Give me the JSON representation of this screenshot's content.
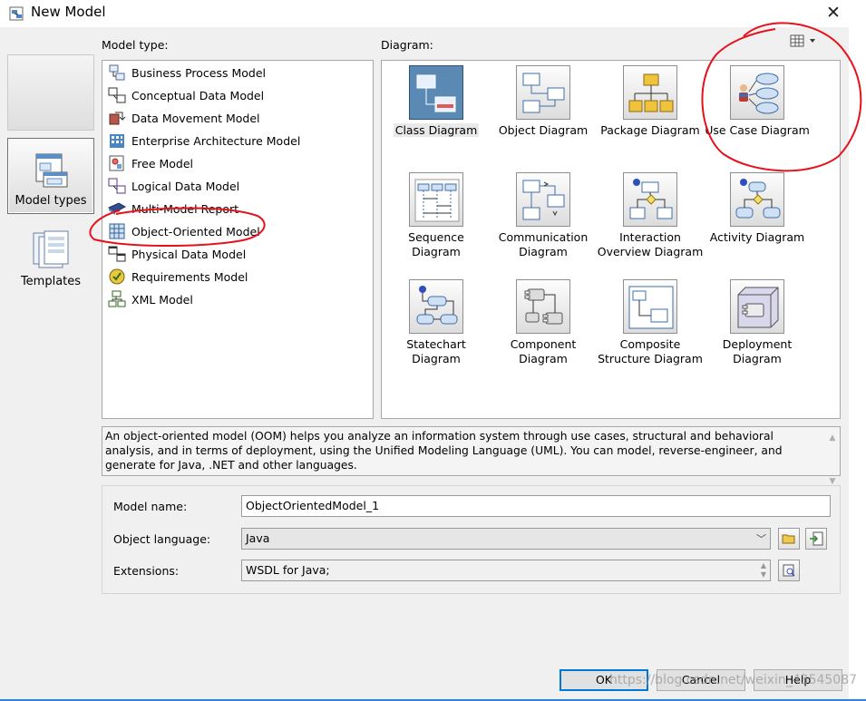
{
  "window": {
    "title": "New Model",
    "close_glyph": "✕",
    "app_icon": "new-model-app-icon"
  },
  "sidebar": {
    "items": [
      {
        "label": "",
        "icon": "blank-category-icon"
      },
      {
        "label": "Model types",
        "icon": "model-types-icon",
        "selected": true
      },
      {
        "label": "Templates",
        "icon": "templates-icon"
      }
    ]
  },
  "model_type": {
    "label": "Model type:",
    "selected": "Object-Oriented Model",
    "items": [
      {
        "label": "Business Process Model",
        "icon": "business-process-icon"
      },
      {
        "label": "Conceptual Data Model",
        "icon": "conceptual-data-icon"
      },
      {
        "label": "Data Movement Model",
        "icon": "data-movement-icon"
      },
      {
        "label": "Enterprise Architecture Model",
        "icon": "enterprise-architecture-icon"
      },
      {
        "label": "Free Model",
        "icon": "free-model-icon"
      },
      {
        "label": "Logical Data Model",
        "icon": "logical-data-icon"
      },
      {
        "label": "Multi-Model Report",
        "icon": "multi-model-report-icon"
      },
      {
        "label": "Object-Oriented Model",
        "icon": "object-oriented-icon"
      },
      {
        "label": "Physical Data Model",
        "icon": "physical-data-icon"
      },
      {
        "label": "Requirements Model",
        "icon": "requirements-icon"
      },
      {
        "label": "XML Model",
        "icon": "xml-model-icon"
      }
    ]
  },
  "diagram": {
    "label": "Diagram:",
    "view_icon": "view-mode-icon",
    "selected": "Class Diagram",
    "items": [
      {
        "label": "Class Diagram",
        "icon": "class-diagram-icon"
      },
      {
        "label": "Object Diagram",
        "icon": "object-diagram-icon"
      },
      {
        "label": "Package Diagram",
        "icon": "package-diagram-icon"
      },
      {
        "label": "Use Case Diagram",
        "icon": "use-case-diagram-icon"
      },
      {
        "label": "Sequence Diagram",
        "icon": "sequence-diagram-icon"
      },
      {
        "label": "Communication Diagram",
        "icon": "communication-diagram-icon"
      },
      {
        "label": "Interaction Overview Diagram",
        "icon": "interaction-overview-icon"
      },
      {
        "label": "Activity Diagram",
        "icon": "activity-diagram-icon"
      },
      {
        "label": "Statechart Diagram",
        "icon": "statechart-diagram-icon"
      },
      {
        "label": "Component Diagram",
        "icon": "component-diagram-icon"
      },
      {
        "label": "Composite Structure Diagram",
        "icon": "composite-structure-icon"
      },
      {
        "label": "Deployment Diagram",
        "icon": "deployment-diagram-icon"
      }
    ]
  },
  "description": "An object-oriented model (OOM) helps you analyze an information system through use cases, structural and behavioral analysis, and in terms of deployment, using the Unified Modeling Language (UML). You can model, reverse-engineer, and generate for Java, .NET and other languages.",
  "properties": {
    "model_name": {
      "label": "Model name:",
      "value": "ObjectOrientedModel_1"
    },
    "object_language": {
      "label": "Object language:",
      "value": "Java"
    },
    "extensions": {
      "label": "Extensions:",
      "value": "WSDL for Java;"
    }
  },
  "buttons": {
    "ok": "OK",
    "cancel": "Cancel",
    "help": "Help"
  },
  "watermark": "https://blog.csdn.net/weixin_43545087",
  "colors": {
    "annotation_red": "#e8101a",
    "accent_blue": "#0078d7",
    "selected_tile": "#5a8ab4"
  }
}
